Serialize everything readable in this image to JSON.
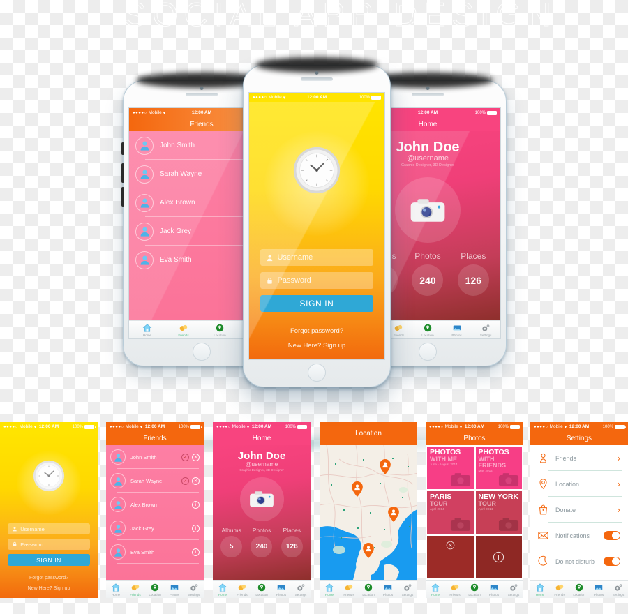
{
  "watermark": "SOCIAL APP DESIGN",
  "status_bar": {
    "carrier": "Mobile",
    "dots": "●●●●○",
    "wifi_icon": "wifi-icon",
    "time": "12:00 AM",
    "battery_percent": "100%"
  },
  "tab_bar": {
    "items": [
      {
        "label": "Home",
        "icon": "home-icon"
      },
      {
        "label": "Friends",
        "icon": "friends-icon"
      },
      {
        "label": "Location",
        "icon": "location-pin-icon"
      },
      {
        "label": "Photos",
        "icon": "photos-icon"
      },
      {
        "label": "Settings",
        "icon": "gear-icon"
      }
    ]
  },
  "login_screen": {
    "title": "Sign In",
    "clock_icon": "clock-icon",
    "username": {
      "placeholder": "Username",
      "value": "",
      "icon": "user-icon"
    },
    "password": {
      "placeholder": "Password",
      "value": "",
      "icon": "lock-icon"
    },
    "signin_label": "SIGN IN",
    "forgot_label": "Forgot password?",
    "signup_label": "New Here? Sign up"
  },
  "friends_screen": {
    "title": "Friends",
    "rows": [
      {
        "name": "John Smith",
        "actions": [
          "check",
          "close"
        ]
      },
      {
        "name": "Sarah Wayne",
        "actions": [
          "check",
          "close"
        ]
      },
      {
        "name": "Alex Brown",
        "actions": [
          "info"
        ]
      },
      {
        "name": "Jack Grey",
        "actions": [
          "info"
        ]
      },
      {
        "name": "Eva Smith",
        "actions": [
          "info"
        ]
      }
    ],
    "active_tab": "Friends"
  },
  "home_screen": {
    "title": "Home",
    "name": "John Doe",
    "username": "@username",
    "role": "Graphic Designer, 3D Designer",
    "avatar_icon": "camera-icon",
    "stats": [
      {
        "label": "Albums",
        "value": "5"
      },
      {
        "label": "Photos",
        "value": "240"
      },
      {
        "label": "Places",
        "value": "126"
      }
    ],
    "active_tab": "Home"
  },
  "location_screen": {
    "title": "Location",
    "pin_count": 4,
    "pin_icon": "map-pin-user-icon",
    "active_tab": "Home"
  },
  "photos_screen": {
    "title": "Photos",
    "tiles": [
      {
        "line1": "PHOTOS",
        "line2": "WITH ME",
        "line3": "June - August 2014"
      },
      {
        "line1": "PHOTOS",
        "line2": "WITH FRIENDS",
        "line3": "May 2014"
      },
      {
        "line1": "PARIS",
        "line2": "TOUR",
        "line3": "April 2014"
      },
      {
        "line1": "NEW YORK",
        "line2": "TOUR",
        "line3": "April 2014"
      }
    ],
    "delete_icon": "close-circle-icon",
    "add_icon": "plus-circle-icon",
    "active_tab": "Home"
  },
  "settings_screen": {
    "title": "Settings",
    "rows": [
      {
        "label": "Friends",
        "icon": "person-outline-icon",
        "control": "chevron"
      },
      {
        "label": "Location",
        "icon": "pin-outline-icon",
        "control": "chevron"
      },
      {
        "label": "Donate",
        "icon": "bag-outline-icon",
        "control": "chevron"
      },
      {
        "label": "Notifications",
        "icon": "envelope-outline-icon",
        "control": "toggle",
        "on": true
      },
      {
        "label": "Do not disturb",
        "icon": "moon-outline-icon",
        "control": "toggle",
        "on": true
      }
    ],
    "active_tab": "Home"
  },
  "colors": {
    "orange": "#f4670e",
    "orange_light": "#fb8a3c",
    "yellow": "#ffe400",
    "pink": "#fb7398",
    "magenta": "#f8447f",
    "blue_button": "#2fa8d6",
    "green_active": "#5cc48f",
    "sea_blue": "#189bf0",
    "map_land": "#f4efe7"
  }
}
